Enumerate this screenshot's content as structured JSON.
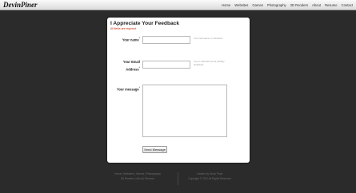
{
  "site": {
    "logo": "DevinPiner"
  },
  "nav": {
    "items": [
      "Home",
      "Websites",
      "Games",
      "Photography",
      "3D Renders",
      "About",
      "Resume",
      "Contact"
    ]
  },
  "form": {
    "title": "I Appreciate Your Feedback",
    "subtitle": "All fields are required",
    "name_label": "Your name",
    "name_hint": "Your real name or nickname.",
    "email_label_line1": "Your Email",
    "email_label_line2": "Address",
    "email_hint": "Your e-mail will not be publicly displayed.",
    "message_label": "Your message",
    "required_mark": "*",
    "submit_label": "Send Message"
  },
  "footer": {
    "left_line1": "Home | Websites | Games | Photography",
    "left_line2": "3D Renders | About | Resume",
    "right_line1": "Created by Devin Piner",
    "right_line2": "Copyright © 2011 All Rights Reserved"
  }
}
